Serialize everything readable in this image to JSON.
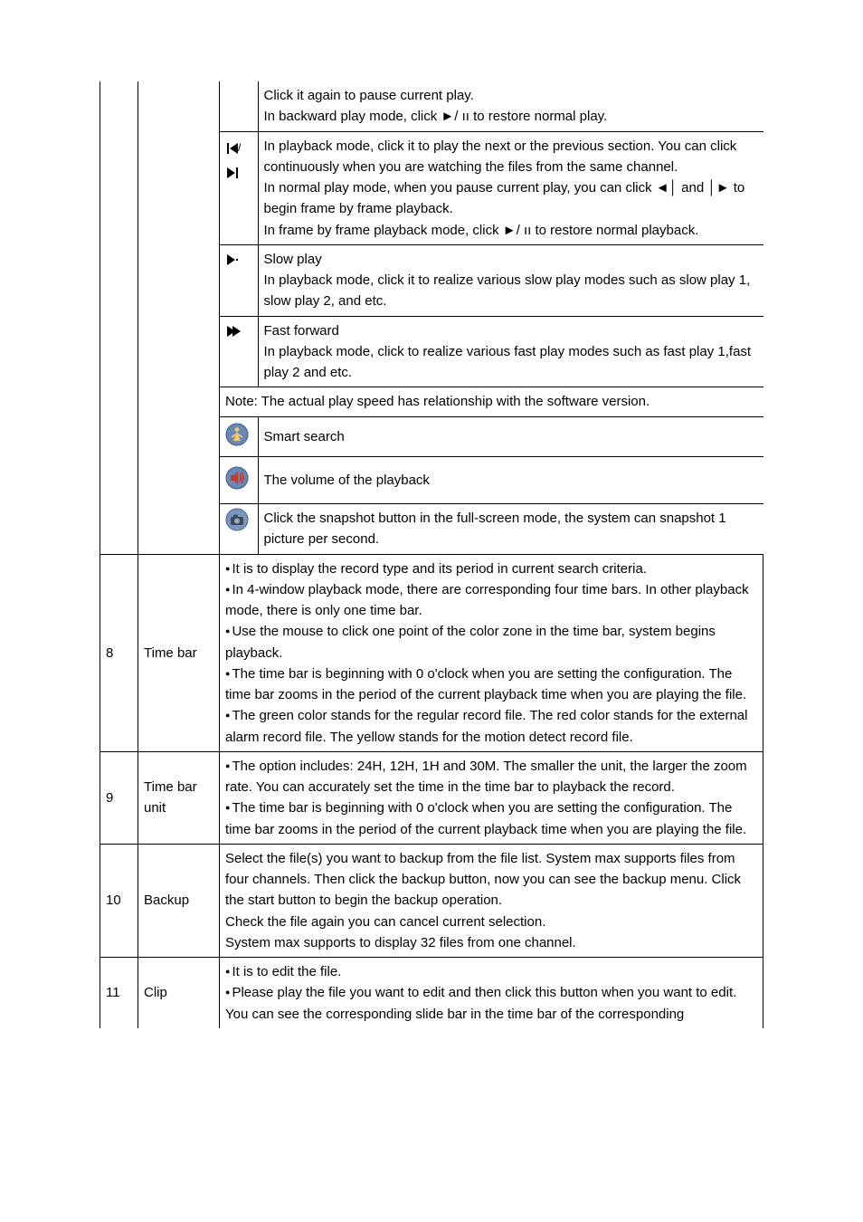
{
  "top": {
    "row0": {
      "a": "Click it again to pause current play.",
      "b": "In backward play mode, click ►/ ıı to restore normal play."
    },
    "row1": {
      "a": "In playback mode, click it to play the next or the previous section. You can click continuously when you are watching the files from the same channel.",
      "b": "In normal play mode, when you pause current play, you can click ◄│ and │► to begin frame by frame playback.",
      "c": "In frame by frame playback mode, click ►/ ıı to restore normal playback."
    },
    "row2": {
      "t": "Slow play",
      "a": "In playback mode, click it to realize various slow play modes such as slow play 1, slow play 2, and etc."
    },
    "row3": {
      "t": "Fast forward",
      "a": "In playback mode, click to realize various fast play modes such as  fast play 1,fast play 2 and etc."
    },
    "note": "Note: The actual play speed has relationship with the software version.",
    "smart": "Smart search",
    "volume": "The volume of the playback",
    "snapshot": "Click the snapshot button in the full-screen mode, the system can snapshot 1 picture per second."
  },
  "rows": {
    "r8": {
      "num": "8",
      "label": "Time bar",
      "b1": "It is to display the record type and its period in current search criteria.",
      "b2": "In 4-window playback mode, there are corresponding four time bars. In other playback mode, there is only one time bar.",
      "b3": "Use the mouse to click one point of the color zone in the time bar, system begins playback.",
      "b4": "The time bar is beginning with 0 o'clock when you are setting the configuration. The time bar zooms in the period of the current playback time when you are playing the file.",
      "b5": "The green color stands for the regular record file. The red color stands for the external alarm record file. The yellow stands for the motion detect record file."
    },
    "r9": {
      "num": "9",
      "label": "Time bar unit",
      "a": "The option includes: 24H, 12H, 1H and 30M. The smaller the unit, the larger the zoom rate. You can accurately set the time in the time bar to playback the record.",
      "b": "The time bar is beginning with 0 o'clock when you are setting the configuration. The time bar zooms in the period of the current playback time when you are playing the file."
    },
    "r10": {
      "num": "10",
      "label": "Backup",
      "text": "Select the file(s) you want to backup from the file list. System max supports files from four channels. Then click the backup button, now you can see the backup menu. Click the start button to begin the backup operation.\nCheck the file again you can cancel current selection.\nSystem max supports to display 32 files from one channel."
    },
    "r11": {
      "num": "11",
      "label": "Clip",
      "b1": "It is to edit the file.",
      "b2": "Please play the file you want to edit and then click this button when you want to edit. You can see the corresponding slide bar in the time bar of the corresponding"
    }
  }
}
